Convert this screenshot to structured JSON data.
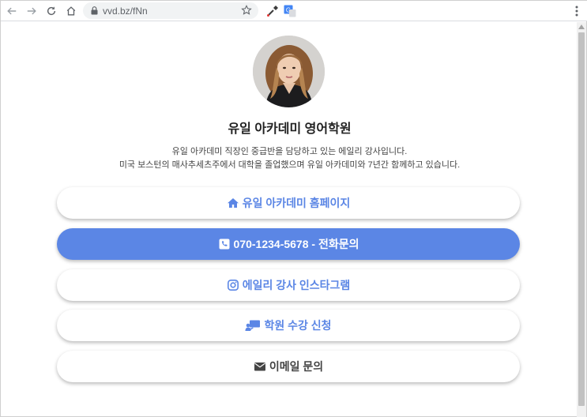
{
  "browser": {
    "url": "vvd.bz/fNn",
    "icons": [
      "back-arrow-icon",
      "forward-arrow-icon",
      "reload-icon",
      "home-icon",
      "lock-icon",
      "bookmark-star-icon",
      "eyedropper-extension-icon",
      "translate-extension-icon",
      "more-menu-icon"
    ]
  },
  "profile": {
    "title": "유일 아카데미 영어학원",
    "description_line1": "유일 아카데미 직장인 중급반을 담당하고 있는 에일리 강사입니다.",
    "description_line2": "미국 보스턴의 매사추세츠주에서 대학을 졸업했으며 유일 아카데미와 7년간 함께하고 있습니다."
  },
  "links": [
    {
      "label": "유일 아카데미 홈페이지",
      "icon": "home-icon"
    },
    {
      "label": "070-1234-5678 - 전화문의",
      "icon": "phone-square-icon"
    },
    {
      "label": "에일리 강사 인스타그램",
      "icon": "instagram-icon"
    },
    {
      "label": "학원 수강 신청",
      "icon": "chalkboard-teacher-icon"
    },
    {
      "label": "이메일 문의",
      "icon": "envelope-icon"
    }
  ],
  "colors": {
    "accent": "#5b86e5",
    "highlight_button_text": "#ffffff",
    "email_button_text": "#444444"
  }
}
